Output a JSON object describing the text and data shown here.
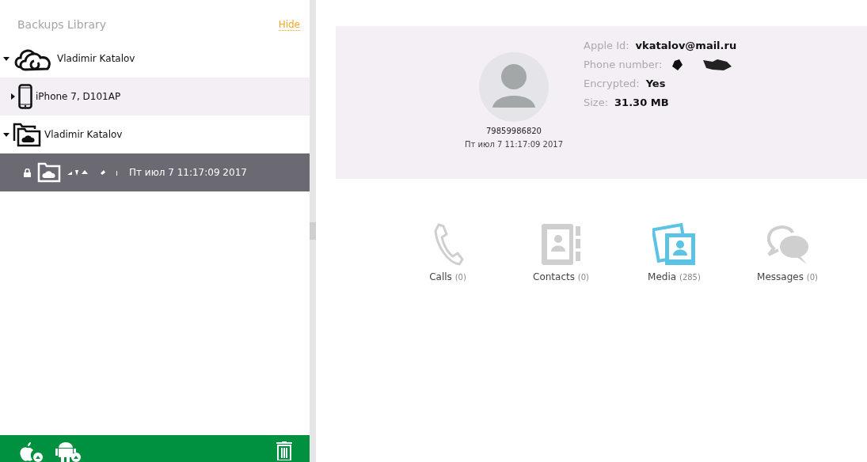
{
  "sidebar": {
    "title": "Backups Library",
    "hide_link": "Hide",
    "tree": [
      {
        "kind": "cloud",
        "label": "Vladimir Katalov",
        "expanded": true,
        "selected": false,
        "children": [
          {
            "kind": "device",
            "label": "iPhone 7, D101AP",
            "expanded": false,
            "selected": false
          }
        ]
      },
      {
        "kind": "folder",
        "label": "Vladimir Katalov",
        "expanded": true,
        "selected": false,
        "children": [
          {
            "kind": "backup",
            "label": "Пт июл 7 11:17:09 2017",
            "locked": true,
            "selected": true
          }
        ]
      }
    ]
  },
  "footer": {
    "buttons": [
      {
        "kind": "apple"
      },
      {
        "kind": "android"
      },
      {
        "kind": "trash"
      }
    ]
  },
  "info": {
    "phone": "79859986820",
    "date": "Пт июл 7 11:17:09 2017",
    "fields": [
      {
        "label": "Apple Id:",
        "value": "vkatalov@mail.ru"
      },
      {
        "label": "Phone number:",
        "redacted": true
      },
      {
        "label": "Encrypted:",
        "value": "Yes"
      },
      {
        "label": "Size:",
        "value": "31.30 MB"
      }
    ]
  },
  "categories": [
    {
      "kind": "calls",
      "label": "Calls",
      "count": "(0)",
      "enabled": false
    },
    {
      "kind": "contacts",
      "label": "Contacts",
      "count": "(0)",
      "enabled": false
    },
    {
      "kind": "media",
      "label": "Media",
      "count": "(285)",
      "enabled": true
    },
    {
      "kind": "messages",
      "label": "Messages",
      "count": "(0)",
      "enabled": false
    }
  ]
}
